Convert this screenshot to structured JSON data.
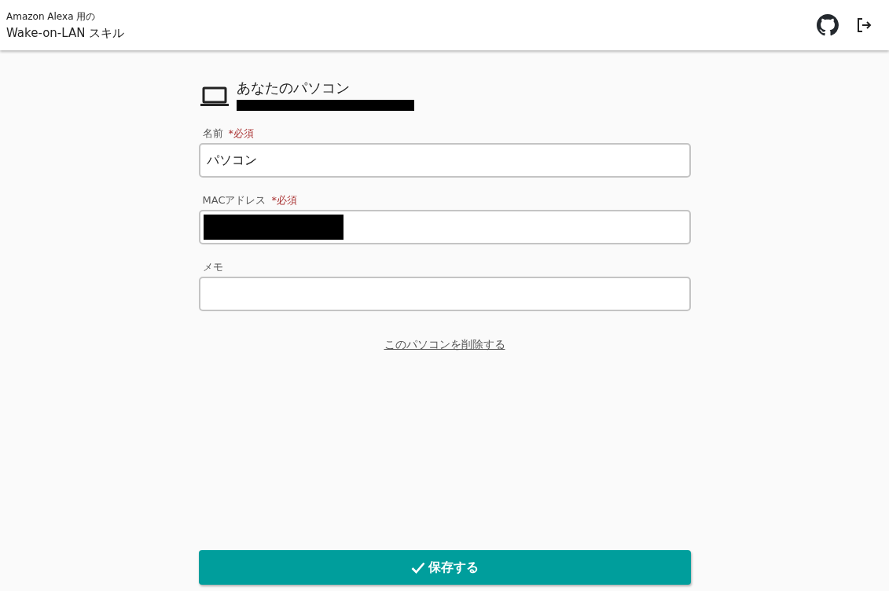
{
  "header": {
    "subtitle": "Amazon Alexa 用の",
    "title": "Wake-on-LAN スキル"
  },
  "device": {
    "title": "あなたのパソコン",
    "id_redacted": true
  },
  "fields": [
    {
      "label": "名前",
      "required_mark": "*必須",
      "value": "パソコン",
      "redacted": false
    },
    {
      "label": "MACアドレス",
      "required_mark": "*必須",
      "redacted": true
    },
    {
      "label": "メモ",
      "redacted": false
    }
  ],
  "delete_link": "このパソコンを削除する",
  "save_button": "保存する"
}
